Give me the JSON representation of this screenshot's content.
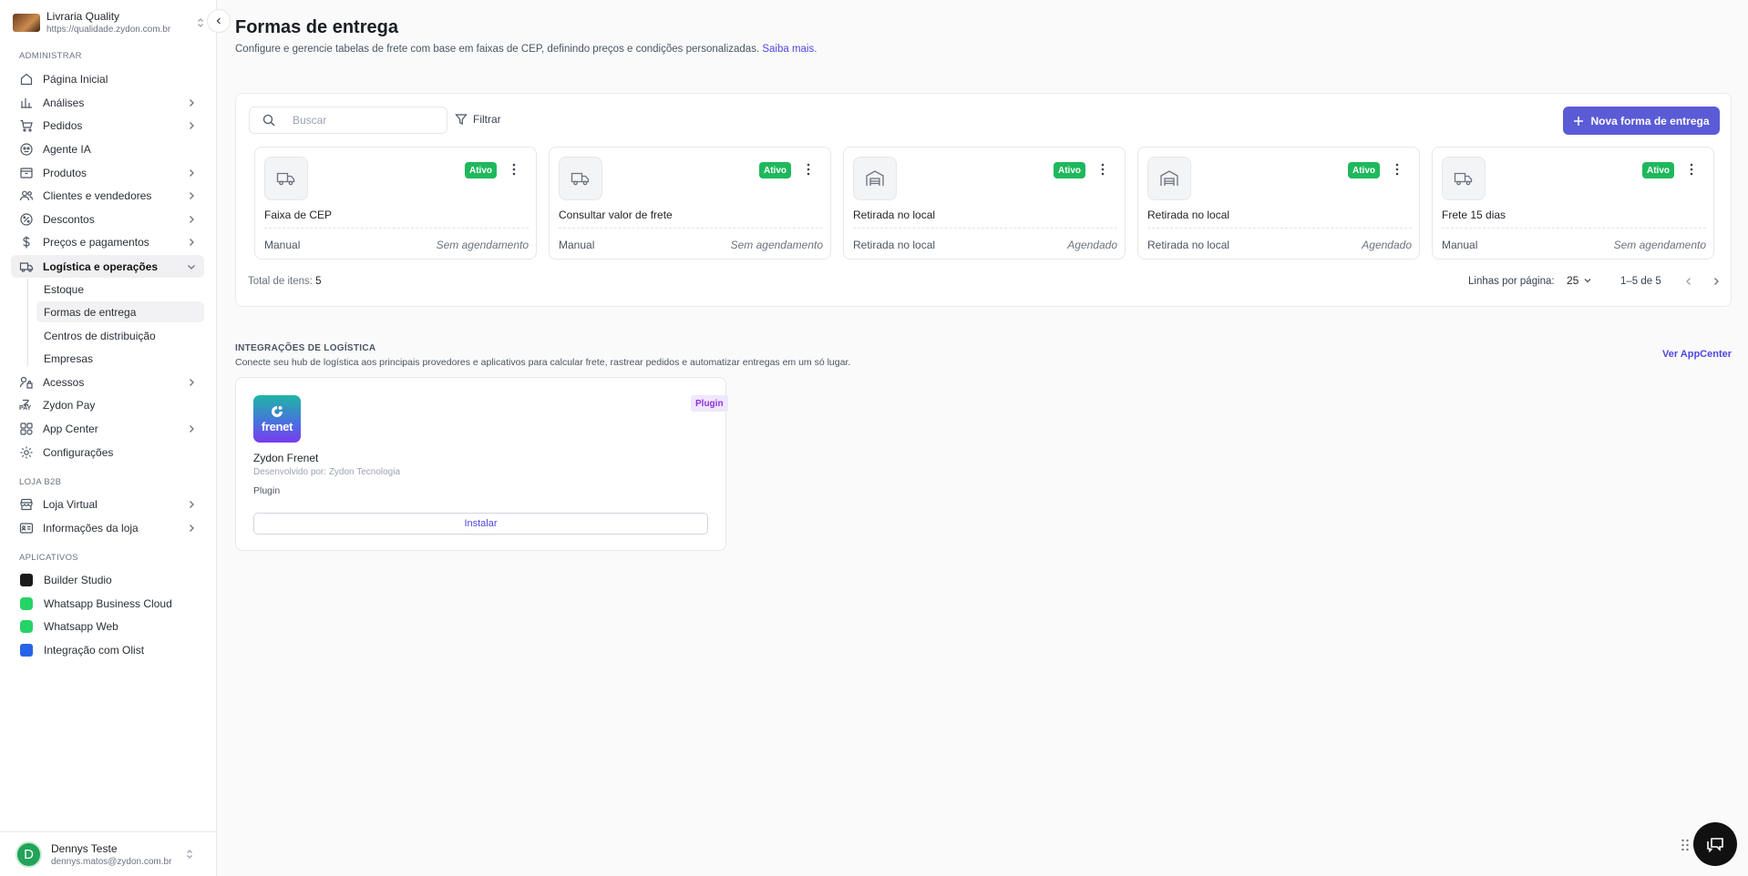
{
  "store": {
    "name": "Livraria Quality",
    "url": "https://qualidade.zydon.com.br"
  },
  "sidebar": {
    "sections": {
      "admin": "ADMINISTRAR",
      "b2b": "LOJA B2B",
      "apps": "APLICATIVOS"
    },
    "items": [
      {
        "label": "Página Inicial",
        "icon": "home-icon"
      },
      {
        "label": "Análises",
        "icon": "bar-chart-icon"
      },
      {
        "label": "Pedidos",
        "icon": "cart-icon"
      },
      {
        "label": "Agente IA",
        "icon": "robot-icon"
      },
      {
        "label": "Produtos",
        "icon": "box-icon"
      },
      {
        "label": "Clientes e vendedores",
        "icon": "users-icon"
      },
      {
        "label": "Descontos",
        "icon": "discount-icon"
      },
      {
        "label": "Preços e pagamentos",
        "icon": "dollar-icon"
      },
      {
        "label": "Logística e operações",
        "icon": "truck-icon"
      },
      {
        "label": "Acessos",
        "icon": "access-icon"
      },
      {
        "label": "Zydon Pay",
        "icon": "pay-icon"
      },
      {
        "label": "App Center",
        "icon": "apps-icon"
      },
      {
        "label": "Configurações",
        "icon": "gear-icon"
      }
    ],
    "subitems": [
      "Estoque",
      "Formas de entrega",
      "Centros de distribuição",
      "Empresas"
    ],
    "b2b_items": [
      {
        "label": "Loja Virtual",
        "icon": "store-icon"
      },
      {
        "label": "Informações da loja",
        "icon": "info-card-icon"
      }
    ],
    "apps": [
      {
        "label": "Builder Studio",
        "color": "#1a1a1a"
      },
      {
        "label": "Whatsapp Business Cloud",
        "color": "#25d366"
      },
      {
        "label": "Whatsapp Web",
        "color": "#25d366"
      },
      {
        "label": "Integração com Olist",
        "color": "#2563eb"
      }
    ]
  },
  "user": {
    "initial": "D",
    "name": "Dennys Teste",
    "email": "dennys.matos@zydon.com.br"
  },
  "page": {
    "title": "Formas de entrega",
    "description": "Configure e gerencie tabelas de frete com base em faixas de CEP, definindo preços e condições personalizadas.",
    "learn_more": "Saiba mais."
  },
  "toolbar": {
    "search_placeholder": "Buscar",
    "filter_label": "Filtrar",
    "new_label": "Nova forma de entrega"
  },
  "cards": [
    {
      "name": "Faixa de CEP",
      "status": "Ativo",
      "type": "Manual",
      "schedule": "Sem agendamento",
      "icon": "truck-icon"
    },
    {
      "name": "Consultar valor de frete",
      "status": "Ativo",
      "type": "Manual",
      "schedule": "Sem agendamento",
      "icon": "truck-icon"
    },
    {
      "name": "Retirada no local",
      "status": "Ativo",
      "type": "Retirada no local",
      "schedule": "Agendado",
      "icon": "warehouse-icon"
    },
    {
      "name": "Retirada no local",
      "status": "Ativo",
      "type": "Retirada no local",
      "schedule": "Agendado",
      "icon": "warehouse-icon"
    },
    {
      "name": "Frete 15 dias",
      "status": "Ativo",
      "type": "Manual",
      "schedule": "Sem agendamento",
      "icon": "truck-icon"
    }
  ],
  "footer": {
    "total_label": "Total de itens:",
    "total_value": "5",
    "rows_label": "Linhas por página:",
    "rows_value": "25",
    "range": "1–5 de 5"
  },
  "integrations": {
    "title": "INTEGRAÇÕES DE LOGÍSTICA",
    "description": "Conecte seu hub de logística aos principais provedores e aplicativos para calcular frete, rastrear pedidos e automatizar entregas em um só lugar.",
    "appcenter_link": "Ver AppCenter",
    "plugin": {
      "logo_text": "frenet",
      "badge": "Plugin",
      "name": "Zydon Frenet",
      "developer": "Desenvolvido por: Zydon Tecnologia",
      "type": "Plugin",
      "install_label": "Instalar"
    }
  },
  "colors": {
    "accent": "#5b5bd6",
    "active_badge": "#1fb85c",
    "plugin_badge": "#8b34d8"
  }
}
